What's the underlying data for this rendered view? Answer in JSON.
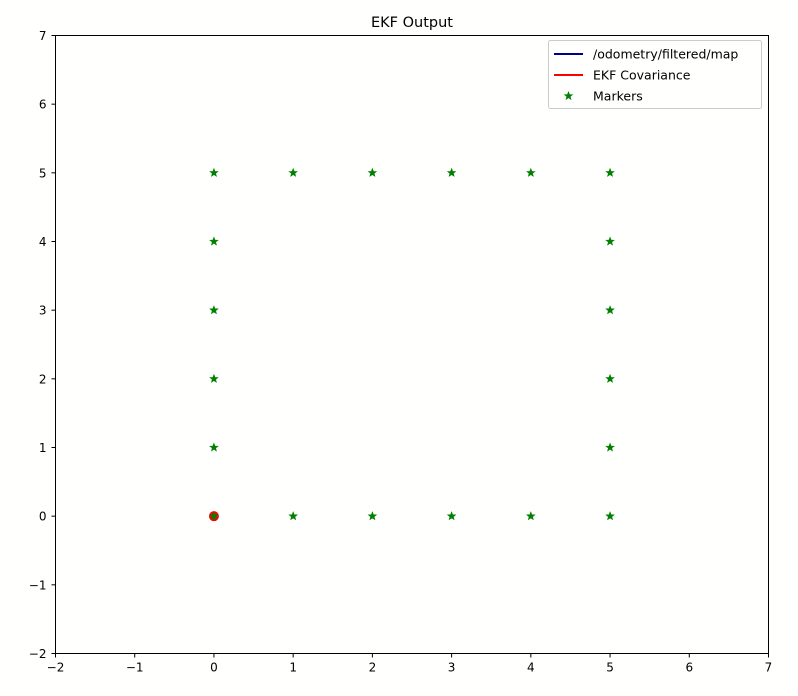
{
  "chart_data": {
    "type": "scatter",
    "title": "EKF Output",
    "xlabel": "",
    "ylabel": "",
    "xlim": [
      -2,
      7
    ],
    "ylim": [
      -2,
      7
    ],
    "x_ticks": [
      -2,
      -1,
      0,
      1,
      2,
      3,
      4,
      5,
      6,
      7
    ],
    "y_ticks": [
      -2,
      -1,
      0,
      1,
      2,
      3,
      4,
      5,
      6,
      7
    ],
    "x_tick_labels": [
      "−2",
      "−1",
      "0",
      "1",
      "2",
      "3",
      "4",
      "5",
      "6",
      "7"
    ],
    "y_tick_labels": [
      "−2",
      "−1",
      "0",
      "1",
      "2",
      "3",
      "4",
      "5",
      "6",
      "7"
    ],
    "grid": false,
    "legend_position": "top-right",
    "series": [
      {
        "name": "/odometry/filtered/map",
        "type": "line",
        "color": "#00008b",
        "points": [
          [
            0,
            0
          ]
        ]
      },
      {
        "name": "EKF Covariance",
        "type": "line",
        "color": "#ff0000",
        "points": [
          [
            0,
            0
          ]
        ]
      },
      {
        "name": "Markers",
        "type": "scatter",
        "marker": "star",
        "color": "#008000",
        "points": [
          [
            0,
            0
          ],
          [
            1,
            0
          ],
          [
            2,
            0
          ],
          [
            3,
            0
          ],
          [
            4,
            0
          ],
          [
            5,
            0
          ],
          [
            0,
            1
          ],
          [
            5,
            1
          ],
          [
            0,
            2
          ],
          [
            5,
            2
          ],
          [
            0,
            3
          ],
          [
            5,
            3
          ],
          [
            0,
            4
          ],
          [
            5,
            4
          ],
          [
            0,
            5
          ],
          [
            1,
            5
          ],
          [
            2,
            5
          ],
          [
            3,
            5
          ],
          [
            4,
            5
          ],
          [
            5,
            5
          ]
        ]
      }
    ]
  }
}
